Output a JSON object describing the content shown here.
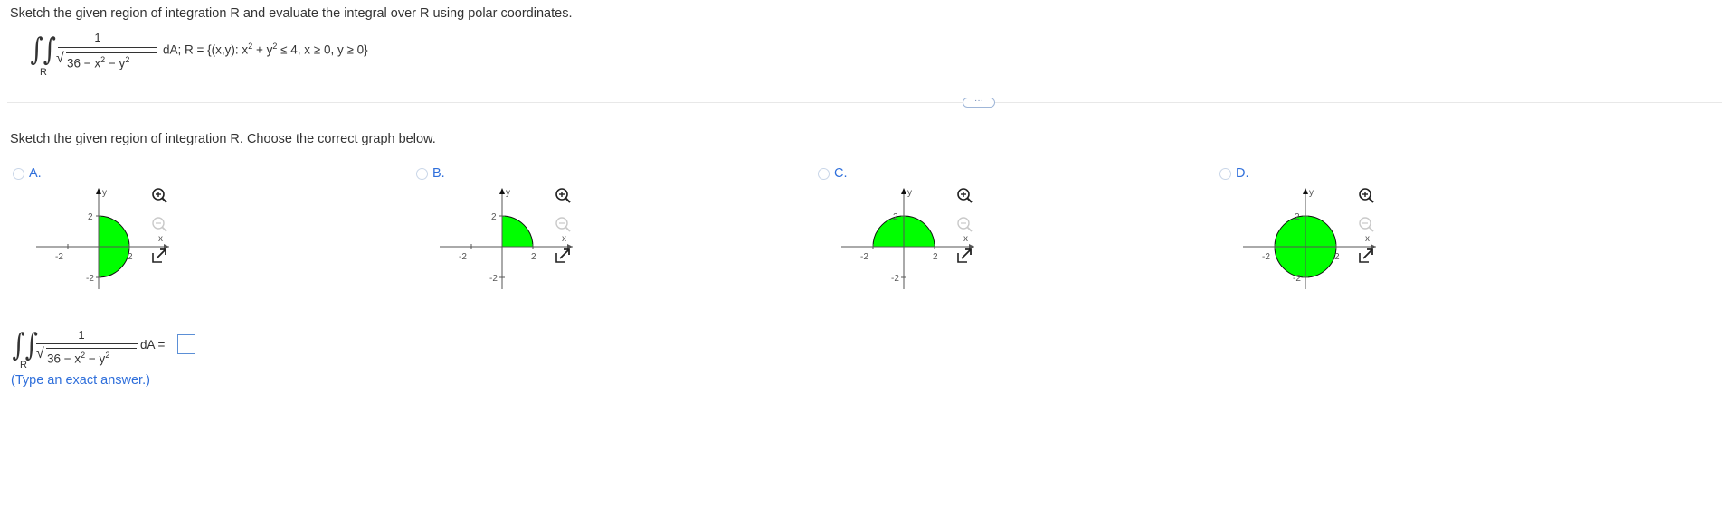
{
  "problem": {
    "instruction": "Sketch the given region of integration R and evaluate the integral over R using polar coordinates.",
    "integrand_numerator": "1",
    "integrand_radicand": "36 − x",
    "exp2": "2",
    "minus_y": " − y",
    "region_label": "R",
    "region_def_prefix": "dA; R =",
    "region_set": "{(x,y): x",
    "region_set_mid": " + y",
    "region_set_end": " ≤ 4, x ≥ 0, y ≥ 0}"
  },
  "expand_button": {
    "label": "···"
  },
  "part1": {
    "prompt": "Sketch the given region of integration R. Choose the correct graph below.",
    "options": [
      {
        "letter": "A.",
        "region": "right-half-disk",
        "ytop": "2",
        "ybot": "-2",
        "xleft": "-2",
        "xright": "2",
        "xlabel": "x",
        "ylabel": "y"
      },
      {
        "letter": "B.",
        "region": "first-quadrant",
        "ytop": "2",
        "ybot": "-2",
        "xleft": "-2",
        "xright": "2",
        "xlabel": "x",
        "ylabel": "y"
      },
      {
        "letter": "C.",
        "region": "upper-half-disk",
        "ytop": "2",
        "ybot": "-2",
        "xleft": "-2",
        "xright": "2",
        "xlabel": "x",
        "ylabel": "y"
      },
      {
        "letter": "D.",
        "region": "full-disk",
        "ytop": "2",
        "ybot": "-2",
        "xleft": "-2",
        "xright": "2",
        "xlabel": "x",
        "ylabel": "y"
      }
    ],
    "fill_color": "#00ff00",
    "icons": [
      "zoom-in-icon",
      "zoom-out-icon",
      "popout-icon"
    ]
  },
  "part2": {
    "integrand_numerator": "1",
    "region_label": "R",
    "dA_label": "dA =",
    "answer_value": "",
    "hint": "(Type an exact answer.)"
  }
}
